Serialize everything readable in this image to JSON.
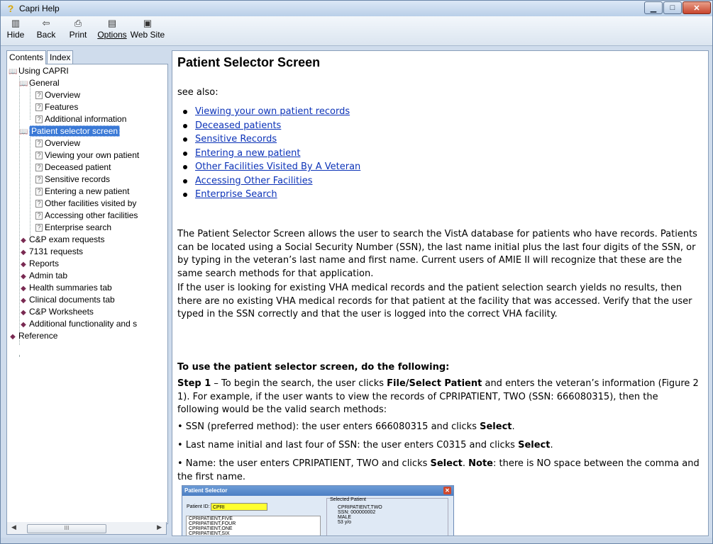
{
  "window": {
    "title": "Capri Help"
  },
  "toolbar": {
    "buttons": [
      {
        "label": "Hide",
        "icon": "hide-icon"
      },
      {
        "label": "Back",
        "icon": "back-arrow-icon"
      },
      {
        "label": "Print",
        "icon": "printer-icon"
      },
      {
        "label": "Options",
        "icon": "options-icon"
      },
      {
        "label": "Web Site",
        "icon": "web-site-icon"
      }
    ]
  },
  "tabs": {
    "contents": "Contents",
    "index": "Index"
  },
  "tree": [
    {
      "label": "Using CAPRI",
      "type": "book"
    },
    {
      "label": "General",
      "type": "book"
    },
    {
      "label": "Overview",
      "type": "page"
    },
    {
      "label": "Features",
      "type": "page"
    },
    {
      "label": "Additional information",
      "type": "page"
    },
    {
      "label": "Patient selector screen",
      "type": "book",
      "selected": true
    },
    {
      "label": "Overview",
      "type": "page"
    },
    {
      "label": "Viewing your own patient",
      "type": "page"
    },
    {
      "label": "Deceased patient",
      "type": "page"
    },
    {
      "label": "Sensitive records",
      "type": "page"
    },
    {
      "label": "Entering a new patient",
      "type": "page"
    },
    {
      "label": "Other facilities visited by",
      "type": "page"
    },
    {
      "label": "Accessing other facilities",
      "type": "page"
    },
    {
      "label": "Enterprise search",
      "type": "page"
    },
    {
      "label": "C&P exam requests",
      "type": "closed-book"
    },
    {
      "label": "7131 requests",
      "type": "closed-book"
    },
    {
      "label": "Reports",
      "type": "closed-book"
    },
    {
      "label": "Admin tab",
      "type": "closed-book"
    },
    {
      "label": "Health summaries tab",
      "type": "closed-book"
    },
    {
      "label": "Clinical documents tab",
      "type": "closed-book"
    },
    {
      "label": "C&P Worksheets",
      "type": "closed-book"
    },
    {
      "label": "Additional functionality and s",
      "type": "closed-book"
    },
    {
      "label": "Reference",
      "type": "closed-book"
    }
  ],
  "content": {
    "heading": "Patient Selector Screen",
    "see_also": "see also:",
    "links": [
      "Viewing your own patient records",
      "Deceased patients",
      "Sensitive Records",
      "Entering a new patient",
      "Other Facilities Visited By A Veteran",
      "Accessing Other Facilities",
      "Enterprise Search"
    ],
    "para1": "The Patient Selector Screen allows the user to search the VistA database for patients who have records. Patients can be located using a Social Security Number (SSN), the last name initial plus the last four digits of the SSN, or by typing in the veteran’s last name and first name. Current users of AMIE II will recognize that these are the same search methods for that application.",
    "para2": "If the user is looking for existing VHA medical records and the patient selection search yields no results, then there are no existing VHA medical records for that patient at the facility that was accessed. Verify that the user typed in the SSN correctly and that the user is logged into the correct VHA facility.",
    "subheading": "To use the patient selector screen, do the following:",
    "step1_label": "Step 1",
    "step1_a": " – To begin the search, the user clicks ",
    "step1_b": "File/Select Patient",
    "step1_c": " and enters the veteran’s information (Figure 2 1). For example, if the user wants to view the records of CPRIPATIENT, TWO (SSN: 666080315), then the following would be the valid search methods:",
    "bullet1_a": "• SSN (preferred method): the user enters 666080315 and clicks ",
    "bullet1_b": "Select",
    "bullet1_c": ".",
    "bullet2_a": "• Last name initial and last four of SSN: the user enters C0315 and clicks ",
    "bullet2_b": "Select",
    "bullet2_c": ".",
    "bullet3_a": "• Name: the user enters CPRIPATIENT, TWO and clicks ",
    "bullet3_b": "Select",
    "bullet3_c": ".  ",
    "bullet3_d": "Note",
    "bullet3_e": ": there is NO space between the comma and the first name."
  },
  "figure": {
    "title": "Patient Selector",
    "patient_id_label": "Patient ID:",
    "patient_id_value": "CPRI",
    "list": [
      "CPRIPATIENT,FIVE",
      "CPRIPATIENT,FOUR",
      "CPRIPATIENT,ONE",
      "CPRIPATIENT,SIX"
    ],
    "selected_group": "Selected Patient",
    "selected": [
      "CPRIPATIENT,TWO",
      "SSN:      000000002",
      "MALE",
      "53 y/o"
    ]
  }
}
